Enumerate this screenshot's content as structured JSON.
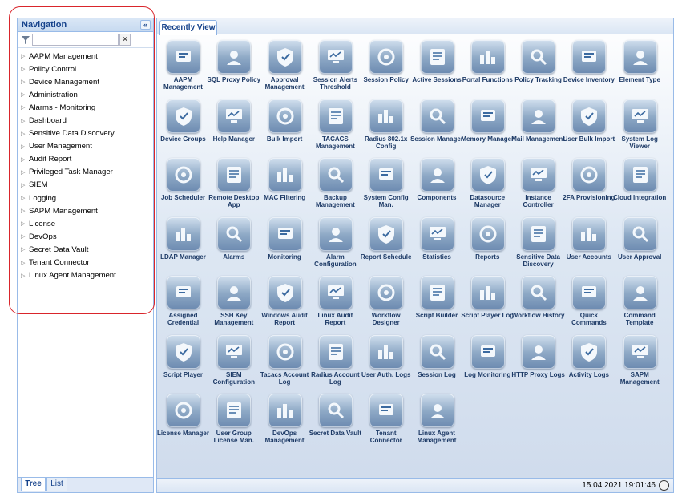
{
  "navigation": {
    "title": "Navigation",
    "collapse_glyph": "«",
    "filter": {
      "value": "",
      "placeholder": ""
    },
    "clear_glyph": "×",
    "items": [
      "AAPM Management",
      "Policy Control",
      "Device Management",
      "Administration",
      "Alarms - Monitoring",
      "Dashboard",
      "Sensitive Data Discovery",
      "User Management",
      "Audit Report",
      "Privileged Task Manager",
      "SIEM",
      "Logging",
      "SAPM Management",
      "License",
      "DevOps",
      "Secret Data Vault",
      "Tenant Connector",
      "Linux Agent Management"
    ],
    "bottom_tabs": {
      "active": "Tree",
      "inactive": "List"
    }
  },
  "main": {
    "tab": "Recently View",
    "tiles": [
      {
        "label": "AAPM Management",
        "icon": "aapm-icon"
      },
      {
        "label": "SQL Proxy Policy",
        "icon": "sql-proxy-icon"
      },
      {
        "label": "Approval Management",
        "icon": "approval-icon"
      },
      {
        "label": "Session Alerts Threshold",
        "icon": "session-alerts-icon"
      },
      {
        "label": "Session Policy",
        "icon": "session-policy-icon"
      },
      {
        "label": "Active Sessions",
        "icon": "active-sessions-icon"
      },
      {
        "label": "Portal Functions",
        "icon": "portal-icon"
      },
      {
        "label": "Policy Tracking",
        "icon": "policy-tracking-icon"
      },
      {
        "label": "Device Inventory",
        "icon": "device-inventory-icon"
      },
      {
        "label": "Element Type",
        "icon": "element-type-icon"
      },
      {
        "label": "Device Groups",
        "icon": "device-groups-icon"
      },
      {
        "label": "Help Manager",
        "icon": "help-icon"
      },
      {
        "label": "Bulk Import",
        "icon": "bulk-import-icon"
      },
      {
        "label": "TACACS Management",
        "icon": "tacacs-icon"
      },
      {
        "label": "Radius 802.1x Config",
        "icon": "radius-icon"
      },
      {
        "label": "Session Manager",
        "icon": "session-manager-icon"
      },
      {
        "label": "Memory Manager",
        "icon": "memory-icon"
      },
      {
        "label": "Mail Management",
        "icon": "mail-icon"
      },
      {
        "label": "User Bulk Import",
        "icon": "user-bulk-import-icon"
      },
      {
        "label": "System Log Viewer",
        "icon": "system-log-icon"
      },
      {
        "label": "Job Scheduler",
        "icon": "job-scheduler-icon"
      },
      {
        "label": "Remote Desktop App",
        "icon": "remote-desktop-icon"
      },
      {
        "label": "MAC Filtering",
        "icon": "mac-filter-icon"
      },
      {
        "label": "Backup Management",
        "icon": "backup-icon"
      },
      {
        "label": "System Config Man.",
        "icon": "system-config-icon"
      },
      {
        "label": "Components",
        "icon": "components-icon"
      },
      {
        "label": "Datasource Manager",
        "icon": "datasource-icon"
      },
      {
        "label": "Instance Controller",
        "icon": "instance-icon"
      },
      {
        "label": "2FA Provisioning",
        "icon": "twofa-icon"
      },
      {
        "label": "Cloud Integration",
        "icon": "cloud-icon"
      },
      {
        "label": "LDAP Manager",
        "icon": "ldap-icon"
      },
      {
        "label": "Alarms",
        "icon": "alarms-icon"
      },
      {
        "label": "Monitoring",
        "icon": "monitoring-icon"
      },
      {
        "label": "Alarm Configuration",
        "icon": "alarm-config-icon"
      },
      {
        "label": "Report Schedule",
        "icon": "report-schedule-icon"
      },
      {
        "label": "Statistics",
        "icon": "statistics-icon"
      },
      {
        "label": "Reports",
        "icon": "reports-icon"
      },
      {
        "label": "Sensitive Data Discovery",
        "icon": "sensitive-data-icon"
      },
      {
        "label": "User Accounts",
        "icon": "user-accounts-icon"
      },
      {
        "label": "User Approval",
        "icon": "user-approval-icon"
      },
      {
        "label": "Assigned Credential",
        "icon": "credential-icon"
      },
      {
        "label": "SSH Key Management",
        "icon": "ssh-key-icon"
      },
      {
        "label": "Windows Audit Report",
        "icon": "windows-audit-icon"
      },
      {
        "label": "Linux Audit Report",
        "icon": "linux-audit-icon"
      },
      {
        "label": "Workflow Designer",
        "icon": "workflow-designer-icon"
      },
      {
        "label": "Script Builder",
        "icon": "script-builder-icon"
      },
      {
        "label": "Script Player Log",
        "icon": "script-player-log-icon"
      },
      {
        "label": "Workflow History",
        "icon": "workflow-history-icon"
      },
      {
        "label": "Quick Commands",
        "icon": "quick-commands-icon"
      },
      {
        "label": "Command Template",
        "icon": "command-template-icon"
      },
      {
        "label": "Script Player",
        "icon": "script-player-icon"
      },
      {
        "label": "SIEM Configuration",
        "icon": "siem-config-icon"
      },
      {
        "label": "Tacacs Account Log",
        "icon": "tacacs-log-icon"
      },
      {
        "label": "Radius Account Log",
        "icon": "radius-log-icon"
      },
      {
        "label": "User Auth. Logs",
        "icon": "user-auth-log-icon"
      },
      {
        "label": "Session Log",
        "icon": "session-log-icon"
      },
      {
        "label": "Log Monitoring",
        "icon": "log-monitoring-icon"
      },
      {
        "label": "HTTP Proxy Logs",
        "icon": "http-proxy-icon"
      },
      {
        "label": "Activity Logs",
        "icon": "activity-logs-icon"
      },
      {
        "label": "SAPM Management",
        "icon": "sapm-icon"
      },
      {
        "label": "License Manager",
        "icon": "license-icon"
      },
      {
        "label": "User Group License Man.",
        "icon": "user-group-license-icon"
      },
      {
        "label": "DevOps Management",
        "icon": "devops-icon"
      },
      {
        "label": "Secret Data Vault",
        "icon": "secret-vault-icon"
      },
      {
        "label": "Tenant Connector",
        "icon": "tenant-connector-icon"
      },
      {
        "label": "Linux Agent Management",
        "icon": "linux-agent-icon"
      }
    ]
  },
  "status_bar": {
    "datetime": "15.04.2021 19:01:46",
    "info_glyph": "i"
  },
  "colors": {
    "highlight_outline": "#d9252b",
    "panel_border": "#99bbe8",
    "title_text": "#15428b"
  }
}
